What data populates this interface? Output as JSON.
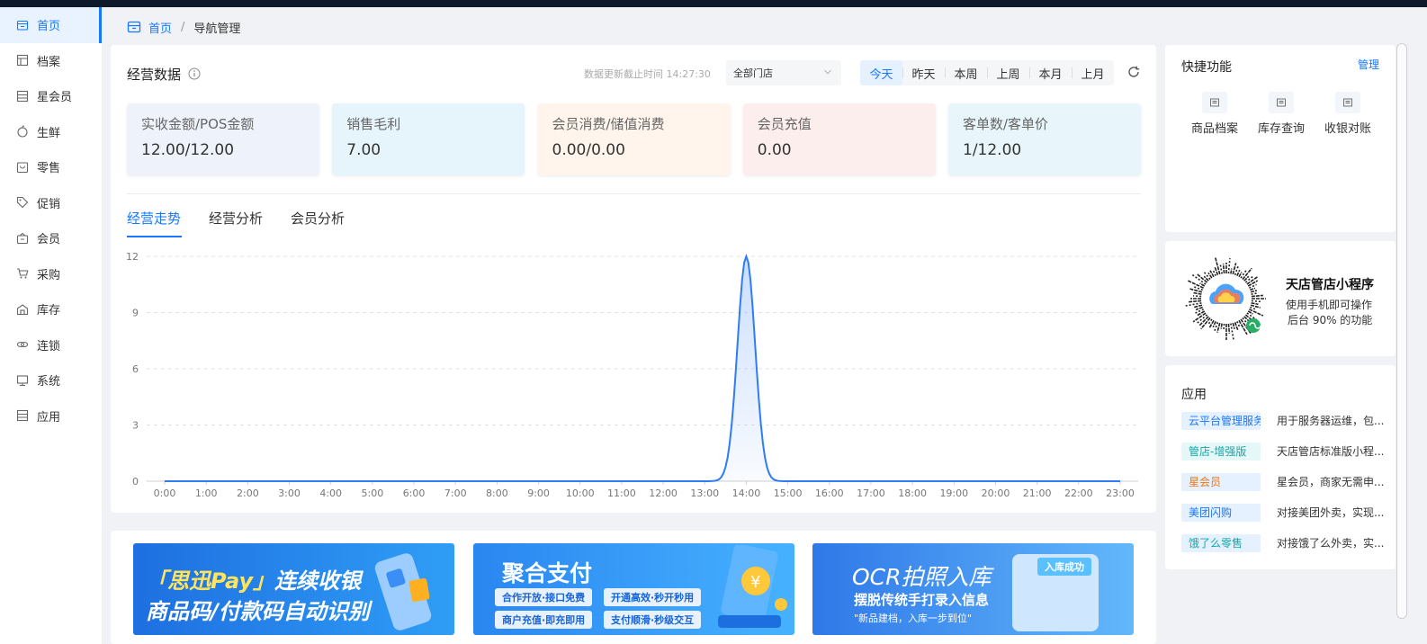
{
  "sidebar": {
    "items": [
      {
        "label": "首页",
        "icon": "home-icon",
        "active": true
      },
      {
        "label": "档案",
        "icon": "archive-icon"
      },
      {
        "label": "星会员",
        "icon": "star-member-icon"
      },
      {
        "label": "生鲜",
        "icon": "fresh-icon"
      },
      {
        "label": "零售",
        "icon": "retail-icon"
      },
      {
        "label": "促销",
        "icon": "tag-icon"
      },
      {
        "label": "会员",
        "icon": "member-icon"
      },
      {
        "label": "采购",
        "icon": "cart-icon"
      },
      {
        "label": "库存",
        "icon": "warehouse-icon"
      },
      {
        "label": "连锁",
        "icon": "chain-icon"
      },
      {
        "label": "系统",
        "icon": "monitor-icon"
      },
      {
        "label": "应用",
        "icon": "app-icon"
      }
    ]
  },
  "breadcrumb": {
    "home": "首页",
    "separator": "/",
    "current": "导航管理"
  },
  "overview": {
    "title": "经营数据",
    "updated_label": "数据更新截止时间 14:27:30",
    "store_select": "全部门店",
    "ranges": [
      "今天",
      "昨天",
      "本周",
      "上周",
      "本月",
      "上月"
    ],
    "active_range": "今天",
    "kpis": [
      {
        "label": "实收金额/POS金额",
        "value": "12.00/12.00"
      },
      {
        "label": "销售毛利",
        "value": "7.00"
      },
      {
        "label": "会员消费/储值消费",
        "value": "0.00/0.00"
      },
      {
        "label": "会员充值",
        "value": "0.00"
      },
      {
        "label": "客单数/客单价",
        "value": "1/12.00"
      }
    ],
    "tabs": [
      "经营走势",
      "经营分析",
      "会员分析"
    ],
    "active_tab": "经营走势"
  },
  "chart_data": {
    "type": "area",
    "x": [
      "0:00",
      "1:00",
      "2:00",
      "3:00",
      "4:00",
      "5:00",
      "6:00",
      "7:00",
      "8:00",
      "9:00",
      "10:00",
      "11:00",
      "12:00",
      "13:00",
      "14:00",
      "15:00",
      "16:00",
      "17:00",
      "18:00",
      "19:00",
      "20:00",
      "21:00",
      "22:00",
      "23:00"
    ],
    "series": [
      {
        "values": [
          0,
          0,
          0,
          0,
          0,
          0,
          0,
          0,
          0,
          0,
          0,
          0,
          0,
          0,
          12,
          0,
          0,
          0,
          0,
          0,
          0,
          0,
          0,
          0
        ]
      }
    ],
    "yticks": [
      "0",
      "3",
      "6",
      "9",
      "12"
    ],
    "ylim": [
      0,
      12
    ],
    "grid": true,
    "color": "#2f7cf6"
  },
  "banners": [
    {
      "title_a": "「思迅Pay」",
      "title_b": "连续收银",
      "subtitle": "商品码/付款码自动识别"
    },
    {
      "title": "聚合支付",
      "pills": [
        "合作开放·接口免费",
        "开通高效·秒开秒用",
        "商户充值·即充即用",
        "支付顺滑·秒级交互"
      ]
    },
    {
      "title": "OCR拍照入库",
      "line2": "摆脱传统手打录入信息",
      "line3": "\"新品建档，入库一步到位\"",
      "badge": "入库成功"
    }
  ],
  "quick": {
    "title": "快捷功能",
    "manage": "管理",
    "items": [
      "商品档案",
      "库存查询",
      "收银对账"
    ]
  },
  "miniprogram": {
    "title": "天店管店小程序",
    "desc1": "使用手机即可操作",
    "desc2": "后台 90% 的功能"
  },
  "apps": {
    "title": "应用",
    "items": [
      {
        "tag": "云平台管理服务费",
        "desc": "用于服务器运维，包...",
        "color": "#1677ff",
        "bg": "#e6f1ff"
      },
      {
        "tag": "管店-增强版",
        "desc": "天店管店标准版小程...",
        "color": "#13a8a8",
        "bg": "#e6f7f7"
      },
      {
        "tag": "星会员",
        "desc": "星会员，商家无需申...",
        "color": "#e8781a",
        "bg": "#e6f1ff"
      },
      {
        "tag": "美团闪购",
        "desc": "对接美团外卖，实现...",
        "color": "#1677ff",
        "bg": "#e6f1ff"
      },
      {
        "tag": "饿了么零售",
        "desc": "对接饿了么外卖，实...",
        "color": "#13a8a8",
        "bg": "#e6f1ff"
      }
    ]
  }
}
